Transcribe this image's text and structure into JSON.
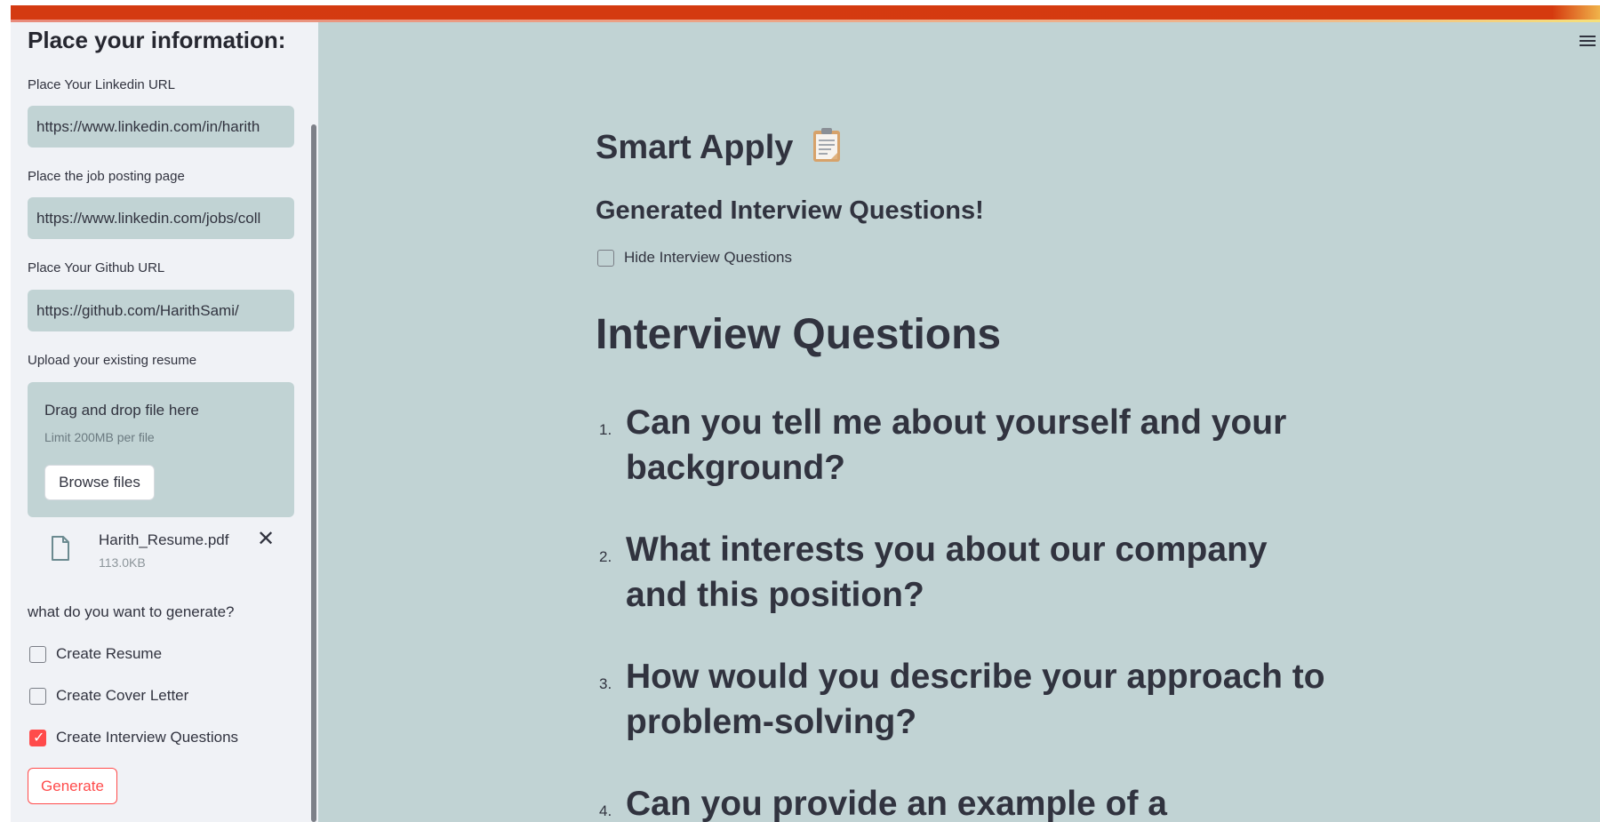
{
  "sidebar": {
    "title": "Place your information:",
    "linkedin": {
      "label": "Place Your Linkedin URL",
      "value": "https://www.linkedin.com/in/harith"
    },
    "job_posting": {
      "label": "Place the job posting page",
      "value": "https://www.linkedin.com/jobs/coll"
    },
    "github": {
      "label": "Place Your Github URL",
      "value": "https://github.com/HarithSami/"
    },
    "upload": {
      "label": "Upload your existing resume",
      "drop_text": "Drag and drop file here",
      "limit_text": "Limit 200MB per file",
      "browse_label": "Browse files",
      "file_name": "Harith_Resume.pdf",
      "file_size": "113.0KB"
    },
    "generate_question": "what do you want to generate?",
    "options": [
      {
        "label": "Create Resume",
        "checked": false
      },
      {
        "label": "Create Cover Letter",
        "checked": false
      },
      {
        "label": "Create Interview Questions",
        "checked": true
      }
    ],
    "generate_label": "Generate"
  },
  "main": {
    "title": "Smart Apply",
    "subtitle": "Generated Interview Questions!",
    "hide_label": "Hide Interview Questions",
    "heading": "Interview Questions",
    "questions": [
      {
        "num": "1.",
        "text": "Can you tell me about yourself and your background?"
      },
      {
        "num": "2.",
        "text": "What interests you about our company and this position?"
      },
      {
        "num": "3.",
        "text": "How would you describe your approach to problem-solving?"
      },
      {
        "num": "4.",
        "text": "Can you provide an example of a"
      }
    ]
  },
  "colors": {
    "accent": "#ff4b4b",
    "main_bg": "#c1d3d4",
    "sidebar_bg": "#f0f2f6",
    "header_bar": "#d43a11"
  }
}
